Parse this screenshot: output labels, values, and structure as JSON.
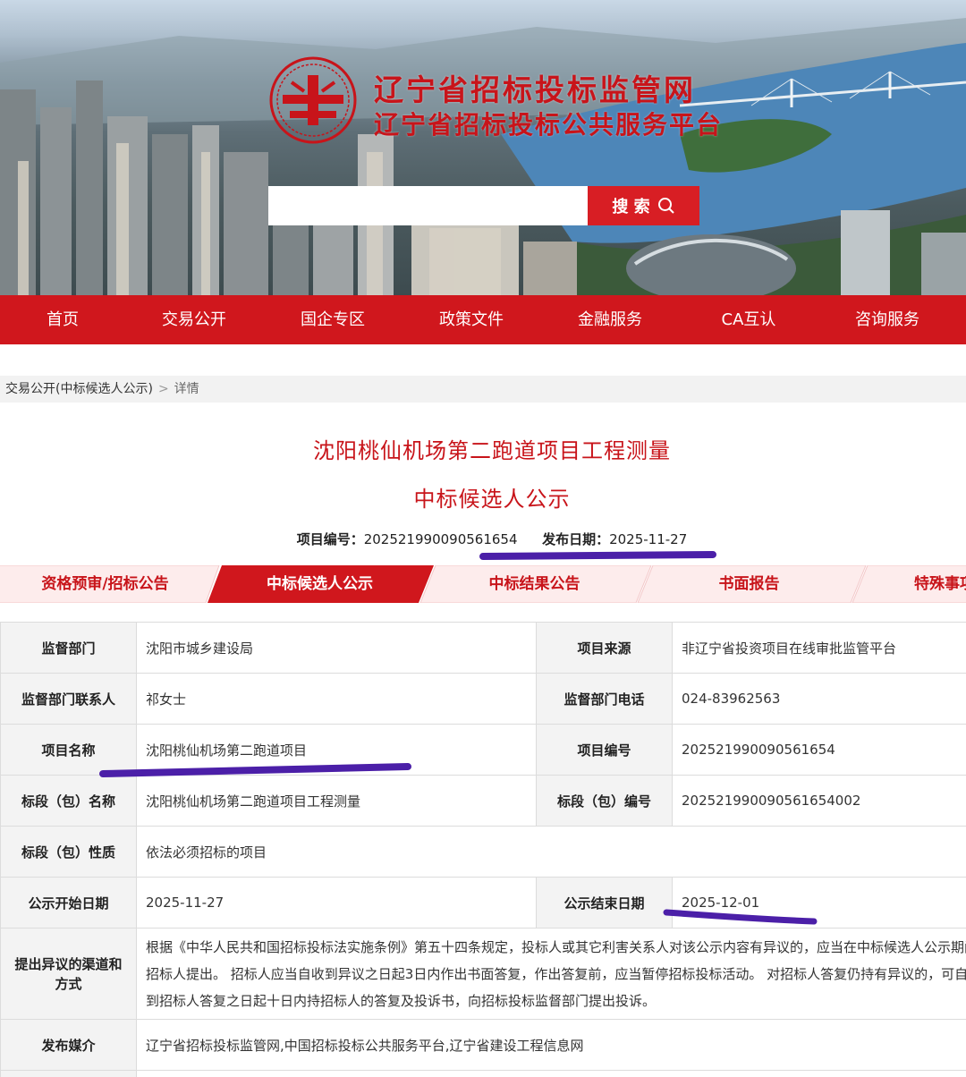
{
  "header": {
    "title_main": "辽宁省招标投标监管网",
    "title_sub": "辽宁省招标投标公共服务平台",
    "search": {
      "placeholder": "",
      "button_label": "搜 索"
    }
  },
  "nav": {
    "items": [
      {
        "label": "首页"
      },
      {
        "label": "交易公开"
      },
      {
        "label": "国企专区"
      },
      {
        "label": "政策文件"
      },
      {
        "label": "金融服务"
      },
      {
        "label": "CA互认"
      },
      {
        "label": "咨询服务"
      }
    ]
  },
  "breadcrumb": {
    "parent": "交易公开(中标候选人公示)",
    "separator": ">",
    "current": "详情"
  },
  "page": {
    "title": "沈阳桃仙机场第二跑道项目工程测量",
    "subtitle": "中标候选人公示",
    "project_no_label": "项目编号：",
    "project_no": "20252199009056165 4",
    "publish_date_label": "发布日期：",
    "publish_date": "2025-11-27"
  },
  "tabs": {
    "items": [
      {
        "label": "资格预审/招标公告",
        "active": false
      },
      {
        "label": "中标候选人公示",
        "active": true
      },
      {
        "label": "中标结果公告",
        "active": false
      },
      {
        "label": "书面报告",
        "active": false
      },
      {
        "label": "特殊事项",
        "active": false
      }
    ]
  },
  "details": {
    "supervisor_dept_label": "监督部门",
    "supervisor_dept": "沈阳市城乡建设局",
    "project_source_label": "项目来源",
    "project_source": "非辽宁省投资项目在线审批监管平台",
    "contact_label": "监督部门联系人",
    "contact": "祁女士",
    "phone_label": "监督部门电话",
    "phone": "024-83962563",
    "project_name_label": "项目名称",
    "project_name": "沈阳桃仙机场第二跑道项目",
    "project_no_label": "项目编号",
    "project_no": "202521990090561654",
    "section_name_label": "标段（包）名称",
    "section_name": "沈阳桃仙机场第二跑道项目工程测量",
    "section_no_label": "标段（包）编号",
    "section_no": "202521990090561654002",
    "section_nature_label": "标段（包）性质",
    "section_nature": "依法必须招标的项目",
    "start_date_label": "公示开始日期",
    "start_date": "2025-11-27",
    "end_date_label": "公示结束日期",
    "end_date": "2025-12-01",
    "objection_label": "提出异议的渠道和方式",
    "objection_text": "根据《中华人民共和国招标投标法实施条例》第五十四条规定，投标人或其它利害关系人对该公示内容有异议的，应当在中标候选人公示期间向招标人提出。 招标人应当自收到异议之日起3日内作出书面答复，作出答复前，应当暂停招标投标活动。 对招标人答复仍持有异议的，可自收到招标人答复之日起十日内持招标人的答复及投诉书，向招标投标监督部门提出投诉。",
    "media_label": "发布媒介",
    "media": "辽宁省招标投标监管网,中国招标投标公共服务平台,辽宁省建设工程信息网"
  },
  "colors": {
    "brand_red": "#d0171d",
    "title_red": "#c8141a",
    "annotation_purple": "#4b1fa8"
  }
}
